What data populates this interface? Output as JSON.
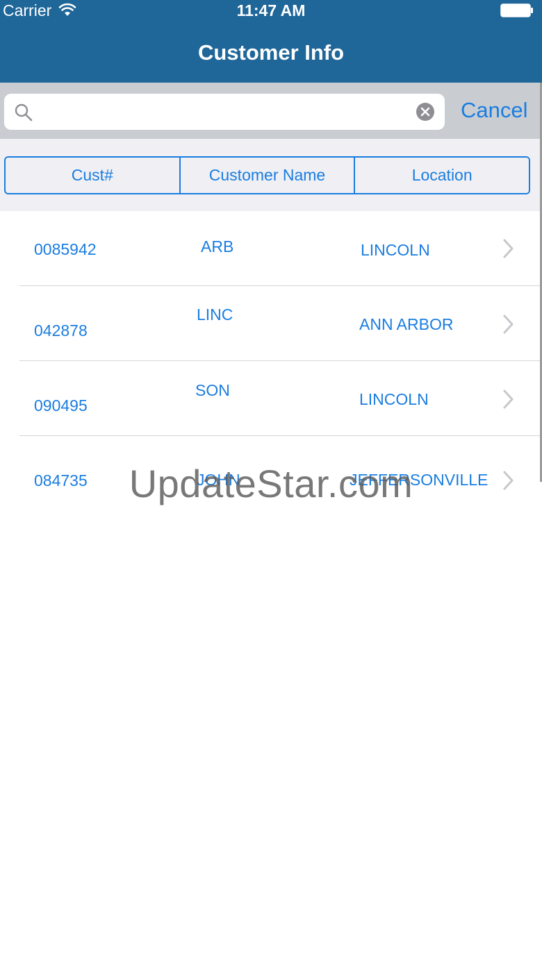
{
  "status_bar": {
    "carrier": "Carrier",
    "time": "11:47 AM"
  },
  "nav": {
    "title": "Customer Info"
  },
  "search": {
    "placeholder": "",
    "value": "",
    "cancel_label": "Cancel"
  },
  "segments": [
    "Cust#",
    "Customer Name",
    "Location"
  ],
  "rows": [
    {
      "cust": "0085942",
      "name": "ARB",
      "location": "LINCOLN"
    },
    {
      "cust": "042878",
      "name": "LINC",
      "location": "ANN ARBOR"
    },
    {
      "cust": "090495",
      "name": "SON",
      "location": "LINCOLN"
    },
    {
      "cust": "084735",
      "name": "JOHN",
      "location": "JEFFERSONVILLE"
    }
  ],
  "watermark": "UpdateStar.com",
  "colors": {
    "nav_bar": "#1f6699",
    "accent": "#1a7de0"
  },
  "icons": [
    "wifi-icon",
    "battery-icon",
    "search-icon",
    "clear-icon",
    "chevron-right-icon"
  ]
}
